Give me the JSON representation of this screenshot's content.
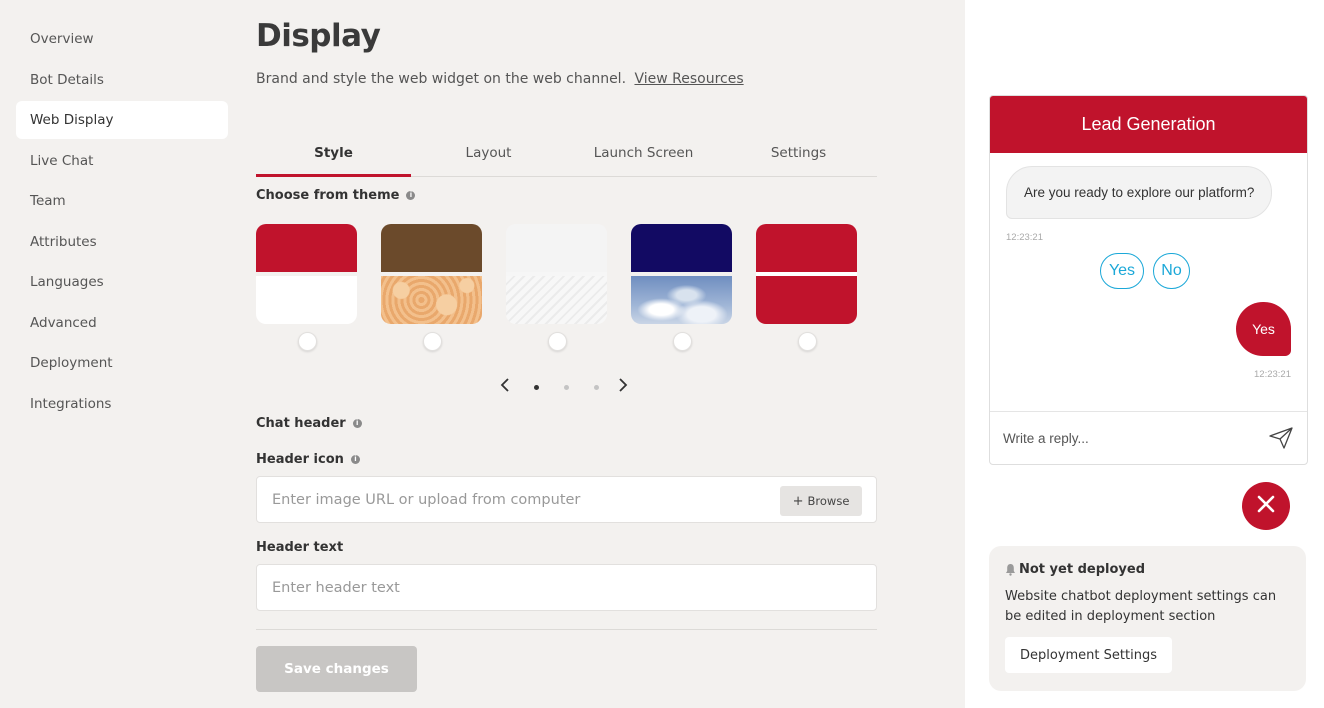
{
  "sidebar": {
    "items": [
      {
        "label": "Overview"
      },
      {
        "label": "Bot Details"
      },
      {
        "label": "Web Display"
      },
      {
        "label": "Live Chat"
      },
      {
        "label": "Team"
      },
      {
        "label": "Attributes"
      },
      {
        "label": "Languages"
      },
      {
        "label": "Advanced"
      },
      {
        "label": "Deployment"
      },
      {
        "label": "Integrations"
      }
    ],
    "active": "Web Display"
  },
  "main": {
    "title": "Display",
    "subtitle": "Brand and style the web widget on the web channel.",
    "resources_link": "View Resources",
    "tabs": [
      {
        "label": "Style"
      },
      {
        "label": "Layout"
      },
      {
        "label": "Launch Screen"
      },
      {
        "label": "Settings"
      }
    ],
    "active_tab": "Style",
    "theme_section_label": "Choose from theme",
    "themes": [
      {
        "top_color": "#c0132c",
        "bottom": "white"
      },
      {
        "top_color": "#6b4a2b",
        "bottom": "sand-pattern"
      },
      {
        "top_color": "#f4f4f4",
        "bottom": "light-stripes"
      },
      {
        "top_color": "#120a63",
        "bottom": "sky-clouds"
      },
      {
        "top_color": "#c0132c",
        "bottom": "#c0132c"
      }
    ],
    "pager": {
      "pages": 3,
      "current": 1
    },
    "chat_header_label": "Chat header",
    "header_icon": {
      "label": "Header icon",
      "placeholder": "Enter image URL or upload from computer",
      "value": "",
      "browse_label": "Browse"
    },
    "header_text": {
      "label": "Header text",
      "placeholder": "Enter header text",
      "value": ""
    },
    "save_label": "Save changes"
  },
  "preview": {
    "header_title": "Lead Generation",
    "bot_message": "Are you ready to explore our platform?",
    "bot_time": "12:23:21",
    "quick_replies": [
      "Yes",
      "No"
    ],
    "user_message": "Yes",
    "user_time": "12:23:21",
    "reply_placeholder": "Write a reply..."
  },
  "deploy_card": {
    "title": "Not yet deployed",
    "text": "Website chatbot deployment settings can be edited in deployment section",
    "button_label": "Deployment Settings"
  },
  "colors": {
    "brand": "#c0132c",
    "quick_reply": "#1ba8d8",
    "background": "#f3f1ef"
  }
}
